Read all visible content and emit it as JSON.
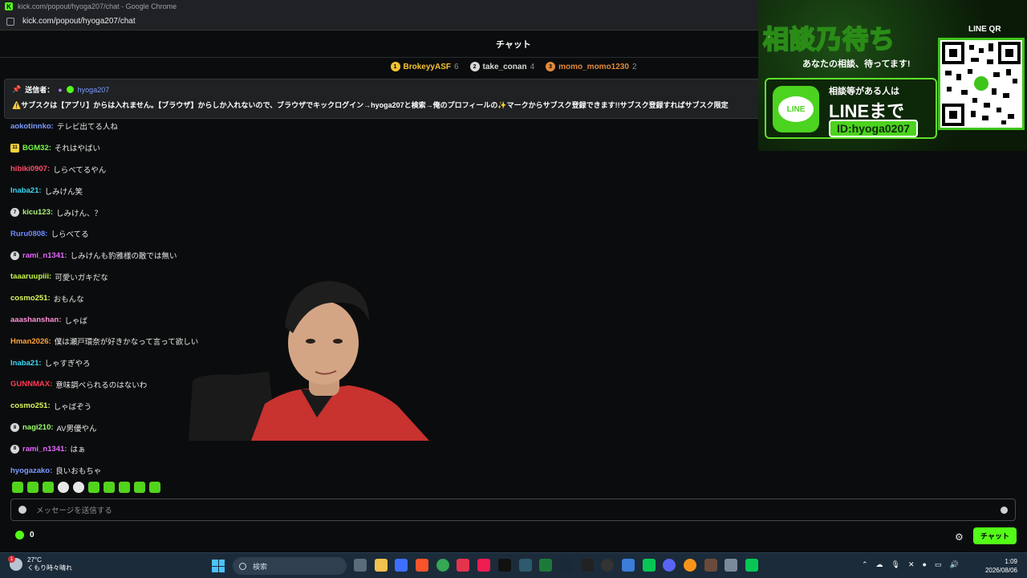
{
  "browser": {
    "window_title": "kick.com/popout/hyoga207/chat - Google Chrome",
    "url": "kick.com/popout/hyoga207/chat"
  },
  "chat": {
    "title": "チャット",
    "top_gifters": [
      {
        "name": "BrokeyyASF",
        "count": "6",
        "rank": "1",
        "color": "#f4c430"
      },
      {
        "name": "take_conan",
        "count": "4",
        "rank": "2",
        "color": "#d9d9d9"
      },
      {
        "name": "momo_momo1230",
        "count": "2",
        "rank": "3",
        "color": "#e08a3c"
      }
    ],
    "pinned": {
      "label": "送信者：",
      "author": "hyoga207",
      "text": "⚠️サブスクは【アプリ】からは入れません。【ブラウザ】からしか入れないので、ブラウザでキックログイン→hyoga207と検索→俺のプロフィールの✨マークからサブスク登録できます!!サブスク登録すればサブスク限定"
    },
    "messages": [
      {
        "user": "aokotinnko",
        "text": "テレビ出てる人ね",
        "color": "#7b9cff"
      },
      {
        "user": "BGM32",
        "text": "それはやばい",
        "color": "#75fd46",
        "badge": "11"
      },
      {
        "user": "hibiki0907",
        "text": "しらべてるやん",
        "color": "#ff4d6d"
      },
      {
        "user": "Inaba21",
        "text": "しみけん笑",
        "color": "#3bd6f5"
      },
      {
        "user": "kicu123",
        "text": "しみけん、？",
        "color": "#a8f07a",
        "badge": "7"
      },
      {
        "user": "Ruru0808",
        "text": "しらべてる",
        "color": "#6e8bff"
      },
      {
        "user": "rami_n1341",
        "text": "しみけんも豹雅様の敵では無い",
        "color": "#e567ff",
        "badge": "8"
      },
      {
        "user": "taaaruupiii",
        "text": "可愛いガキだな",
        "color": "#c5f54a"
      },
      {
        "user": "cosmo251",
        "text": "おもんな",
        "color": "#d9f75a"
      },
      {
        "user": "aaashanshan",
        "text": "しゃば",
        "color": "#ff8fd6"
      },
      {
        "user": "Hman2026",
        "text": "僕は瀬戸環奈が好きかなって言って欲しい",
        "color": "#ffa43b"
      },
      {
        "user": "Inaba21",
        "text": "しゃすぎやろ",
        "color": "#3bd6f5"
      },
      {
        "user": "GUNNMAX",
        "text": "意味調べられるのはないわ",
        "color": "#ff3b55"
      },
      {
        "user": "cosmo251",
        "text": "しゃばぞう",
        "color": "#d9f75a"
      },
      {
        "user": "nagi210",
        "text": "AV男優やん",
        "color": "#9dff6e",
        "badge": "8"
      },
      {
        "user": "rami_n1341",
        "text": "はぁ",
        "color": "#e567ff",
        "badge": "8"
      },
      {
        "user": "hyogazako",
        "text": "良いおもちゃ",
        "color": "#7b9cff"
      }
    ],
    "input_placeholder": "メッセージを送信する",
    "points": "0",
    "send_label": "チャット"
  },
  "ad": {
    "headline": "相談乃待ち",
    "subline": "あなたの相談、待ってます!",
    "line1": "相談等がある人は",
    "line2": "LINEまで",
    "line_id": "ID:hyoga0207",
    "qr_label": "LINE QR",
    "logo_text": "LINE"
  },
  "taskbar": {
    "temperature": "27°C",
    "weather": "くもり時々晴れ",
    "notif_count": "1",
    "search_placeholder": "検索",
    "time": "1:09",
    "date": "2026/08/06"
  }
}
